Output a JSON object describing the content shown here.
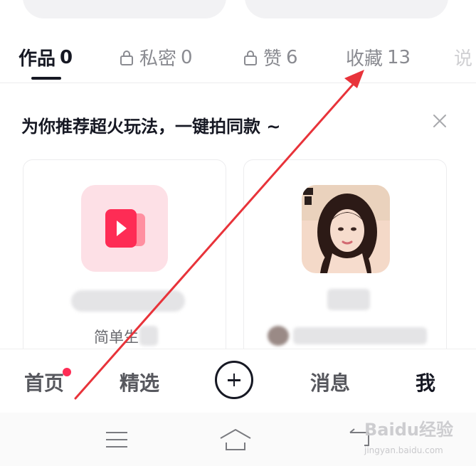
{
  "tabs": [
    {
      "label": "作品",
      "count": "0",
      "locked": false,
      "active": true
    },
    {
      "label": "私密",
      "count": "0",
      "locked": true,
      "active": false
    },
    {
      "label": "赞",
      "count": "6",
      "locked": true,
      "active": false
    },
    {
      "label": "收藏",
      "count": "13",
      "locked": false,
      "active": false
    },
    {
      "label": "说",
      "count": "",
      "locked": false,
      "active": false
    }
  ],
  "recommend": {
    "title": "为你推荐超火玩法，一键拍同款 ~",
    "cards": [
      {
        "creator_text": "简单生"
      },
      {
        "creator_text": ""
      }
    ]
  },
  "bottom_nav": {
    "home": "首页",
    "featured": "精选",
    "messages": "消息",
    "me": "我"
  },
  "watermark": {
    "brand": "Baidu经验",
    "url": "jingyan.baidu.com"
  },
  "colors": {
    "accent": "#fe2c55",
    "annotation_arrow": "#e8333a",
    "text_primary": "#161823",
    "text_secondary": "#8a8b91"
  }
}
